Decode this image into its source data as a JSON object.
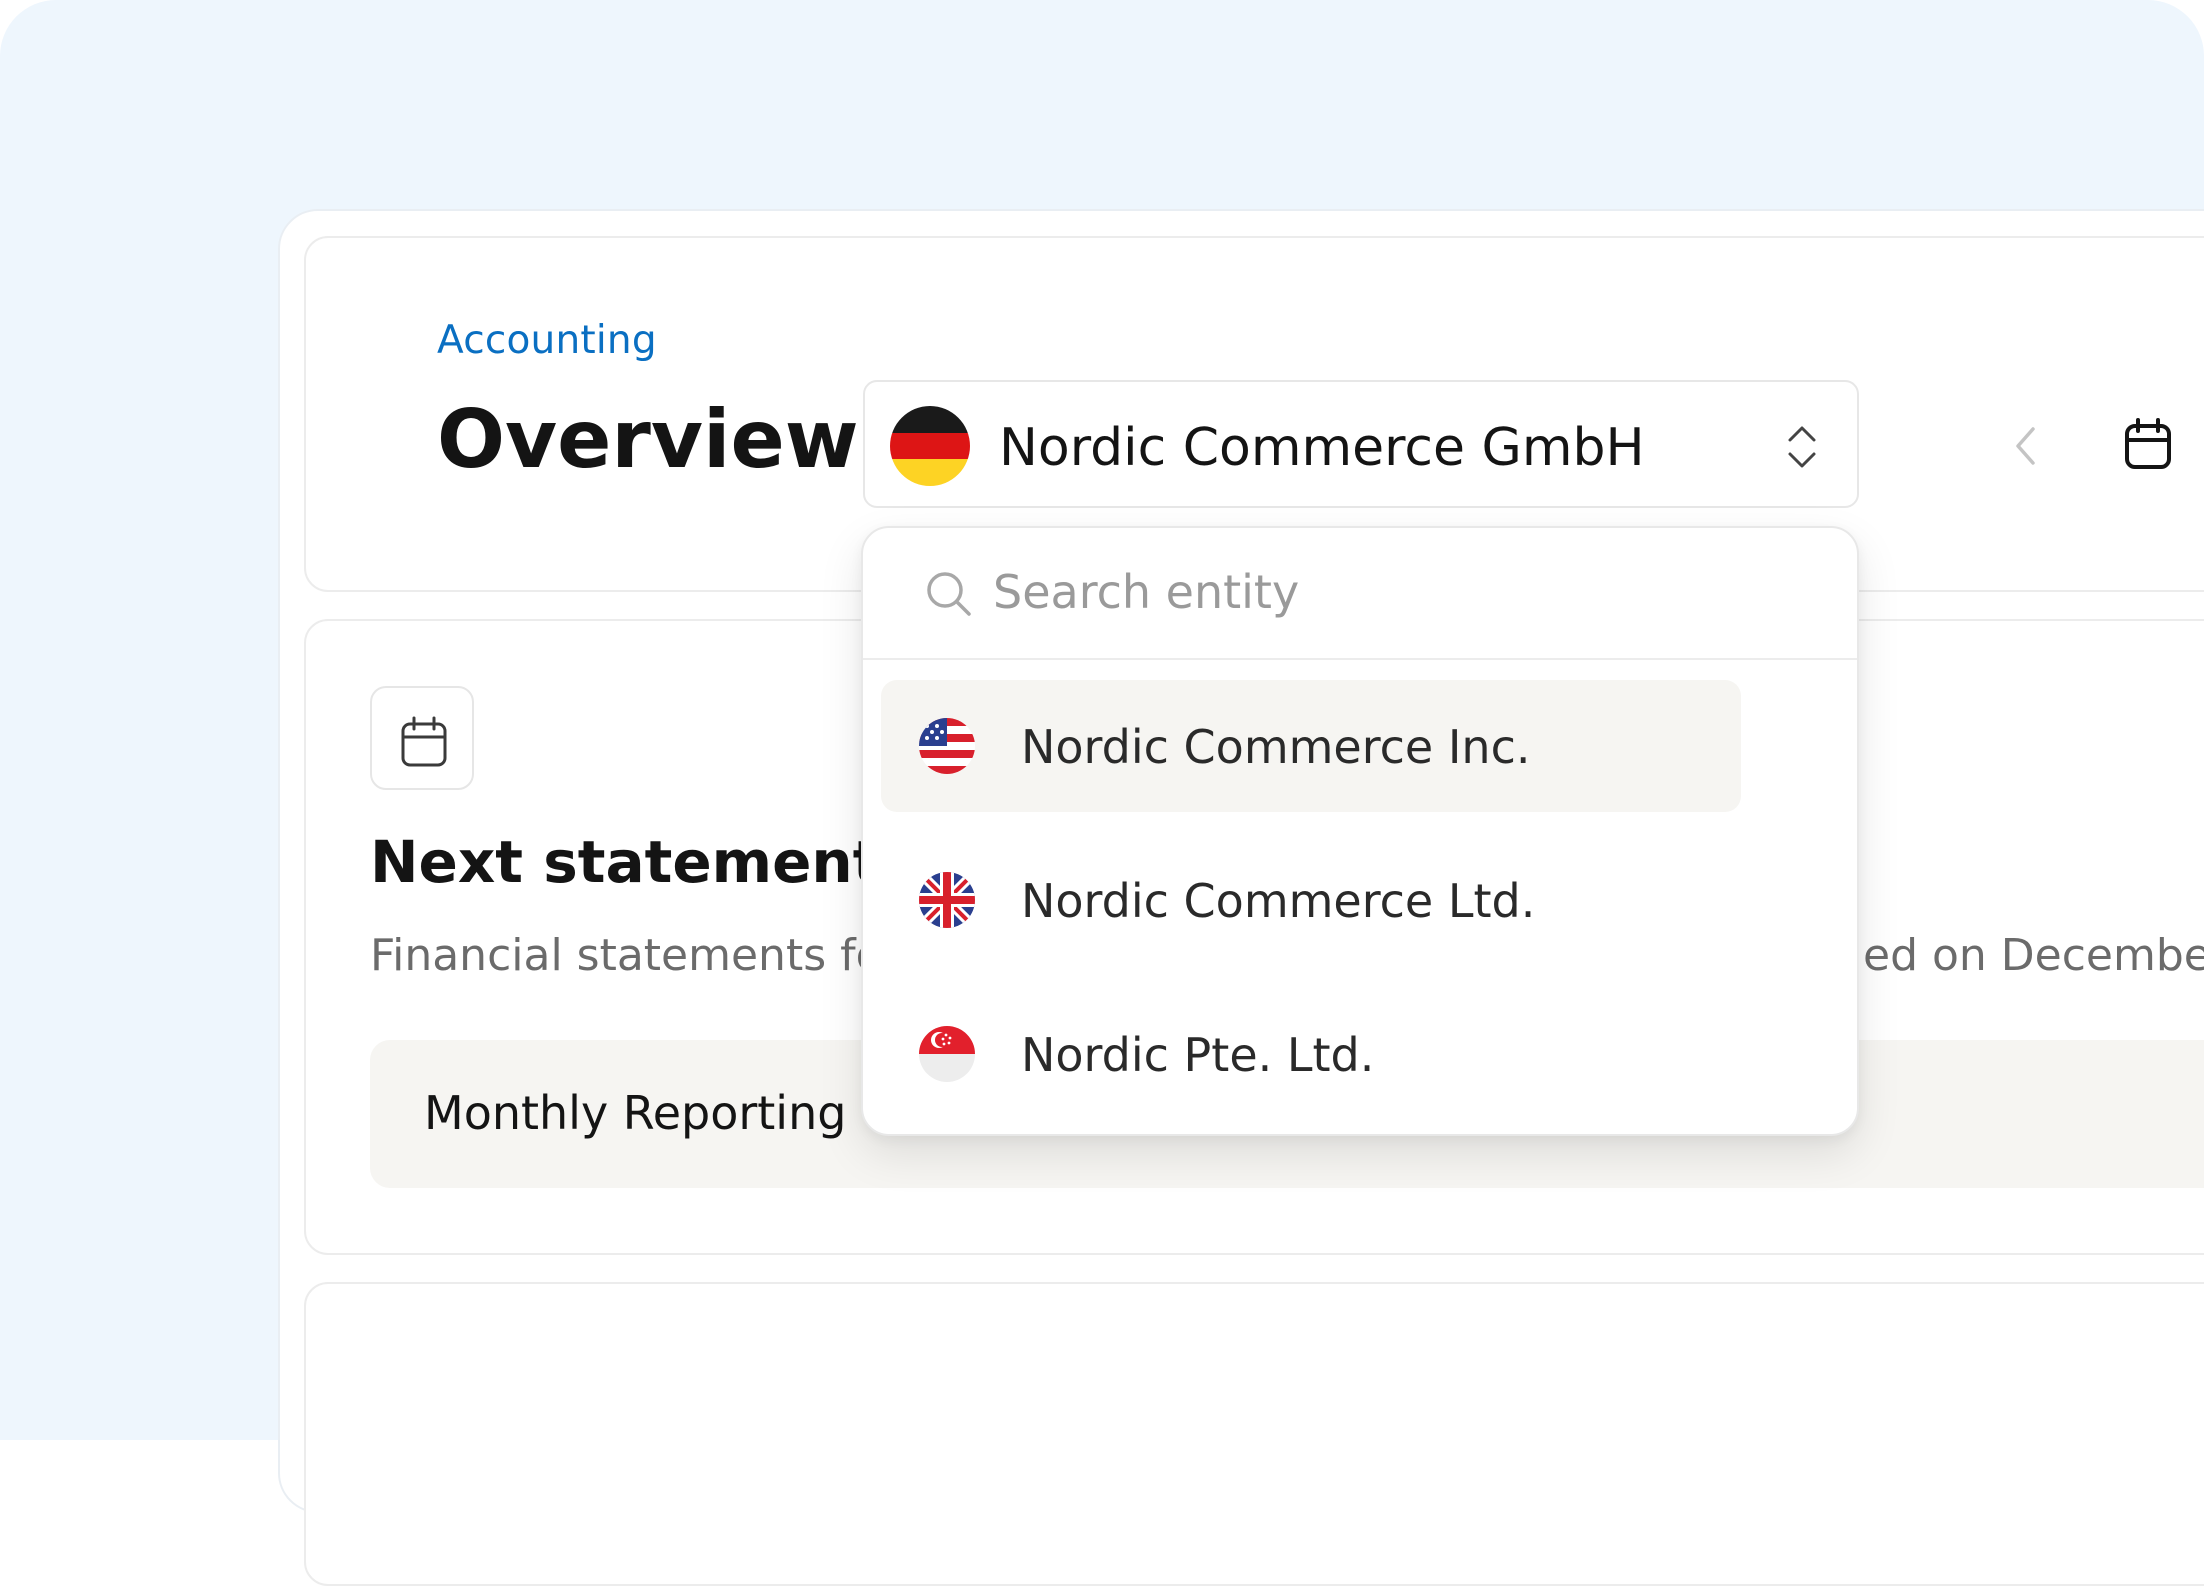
{
  "header": {
    "breadcrumb": "Accounting",
    "title": "Overview",
    "entity_select": {
      "selected_label": "Nordic Commerce GmbH",
      "selected_flag": "germany-flag"
    },
    "icons": [
      "chevron-left-icon",
      "calendar-icon"
    ]
  },
  "dropdown": {
    "search_placeholder": "Search entity",
    "options": [
      {
        "label": "Nordic Commerce Inc.",
        "flag": "usa-flag",
        "highlighted": true
      },
      {
        "label": "Nordic Commerce Ltd.",
        "flag": "uk-flag",
        "highlighted": false
      },
      {
        "label": "Nordic Pte. Ltd.",
        "flag": "singapore-flag",
        "highlighted": false
      }
    ]
  },
  "statement_card": {
    "title_visible": "Next statement D",
    "subtitle_visible_start": "Financial statements fo",
    "subtitle_visible_end": "ed on December",
    "row_label": "Monthly Reporting"
  },
  "colors": {
    "background": "#eef6fd",
    "breadcrumb": "#0a6fc2",
    "highlight": "#f6f5f2"
  }
}
